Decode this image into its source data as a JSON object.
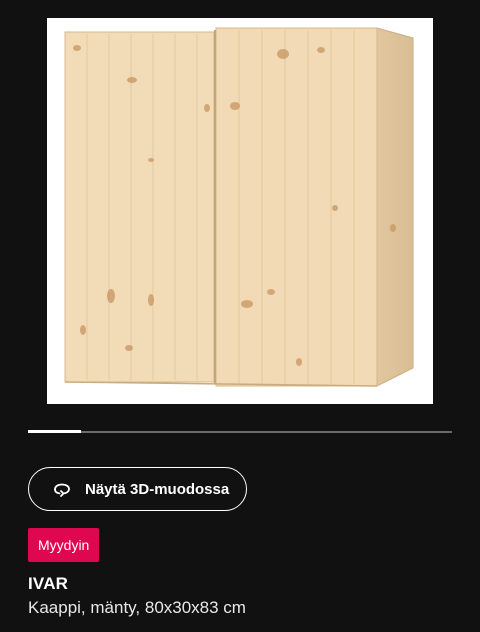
{
  "product": {
    "image_alt": "IVAR cabinet, pine",
    "carousel_progress": 0.125,
    "view_3d_label": "Näytä 3D-muodossa",
    "badge_label": "Myydyin",
    "name": "IVAR",
    "description": "Kaappi, mänty, 80x30x83 cm"
  },
  "icons": {
    "rotate": "rotate-3d-icon"
  },
  "colors": {
    "background": "#111111",
    "badge": "#e00751",
    "wood": "#f0d9b5"
  }
}
